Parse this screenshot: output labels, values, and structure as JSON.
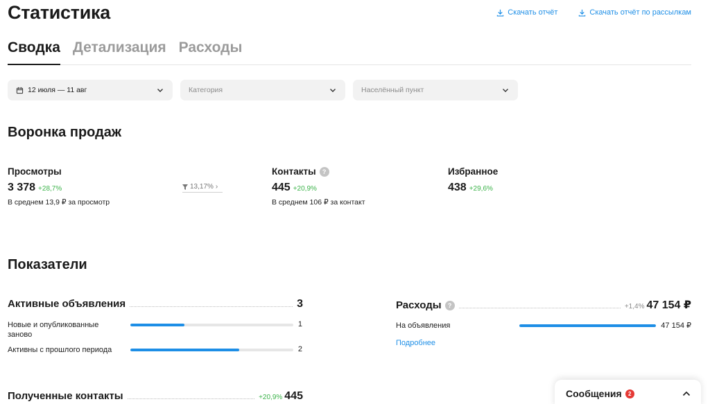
{
  "page": {
    "title": "Статистика"
  },
  "top_links": [
    {
      "label": "Скачать отчёт",
      "icon": "download-icon"
    },
    {
      "label": "Скачать отчёт по рассылкам",
      "icon": "download-icon"
    }
  ],
  "tabs": [
    {
      "label": "Сводка",
      "active": true
    },
    {
      "label": "Детализация",
      "active": false
    },
    {
      "label": "Расходы",
      "active": false
    }
  ],
  "filters": {
    "date": {
      "value": "12 июля — 11 авг",
      "icon": "calendar-icon"
    },
    "category": {
      "placeholder": "Категория"
    },
    "location": {
      "placeholder": "Населённый пункт"
    }
  },
  "funnel": {
    "title": "Воронка продаж",
    "views": {
      "label": "Просмотры",
      "value": "3 378",
      "delta": "+28,7%",
      "sub": "В среднем 13,9 ₽ за просмотр"
    },
    "conversion": {
      "value": "13,17%",
      "icon": "filter-icon"
    },
    "contacts": {
      "label": "Контакты",
      "value": "445",
      "delta": "+20,9%",
      "sub": "В среднем 106 ₽ за контакт"
    },
    "favorites": {
      "label": "Избранное",
      "value": "438",
      "delta": "+29,6%"
    }
  },
  "indicators": {
    "title": "Показатели",
    "active_ads": {
      "label": "Активные объявления",
      "total": "3",
      "rows": [
        {
          "label": "Новые и опубликованные заново",
          "value": "1",
          "fill": 0.33
        },
        {
          "label": "Активны с прошлого периода",
          "value": "2",
          "fill": 0.67
        }
      ]
    },
    "expenses": {
      "label": "Расходы",
      "delta": "+1,4%",
      "total": "47 154 ₽",
      "rows": [
        {
          "label": "На объявления",
          "value": "47 154 ₽",
          "fill": 1.0
        }
      ],
      "more": "Подробнее"
    },
    "received_contacts": {
      "label": "Полученные контакты",
      "delta": "+20,9%",
      "total": "445"
    }
  },
  "messages": {
    "label": "Сообщения",
    "badge": "2"
  }
}
